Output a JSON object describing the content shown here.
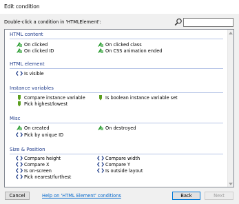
{
  "window": {
    "title": "Edit condition"
  },
  "prompt": "Double-click a condition in 'HTMLElement':",
  "search": {
    "value": "",
    "placeholder": ""
  },
  "groups": [
    {
      "title": "HTML content",
      "items": [
        {
          "label": "On clicked",
          "icon": "trigger-arrow-icon"
        },
        {
          "label": "On clicked class",
          "icon": "trigger-arrow-icon"
        },
        {
          "label": "On clicked ID",
          "icon": "trigger-arrow-icon"
        },
        {
          "label": "On CSS animation ended",
          "icon": "trigger-arrow-icon"
        }
      ]
    },
    {
      "title": "HTML element",
      "items": [
        {
          "label": "Is visible",
          "icon": "code-brackets-icon"
        }
      ]
    },
    {
      "title": "Instance variables",
      "items": [
        {
          "label": "Compare instance variable",
          "icon": "variable-tag-icon"
        },
        {
          "label": "Is boolean instance variable set",
          "icon": "variable-tag-icon"
        },
        {
          "label": "Pick highest/lowest",
          "icon": "variable-tag-icon"
        }
      ]
    },
    {
      "title": "Misc",
      "items": [
        {
          "label": "On created",
          "icon": "trigger-arrow-icon"
        },
        {
          "label": "On destroyed",
          "icon": "trigger-arrow-icon"
        },
        {
          "label": "Pick by unique ID",
          "icon": "code-brackets-icon"
        }
      ]
    },
    {
      "title": "Size & Position",
      "items": [
        {
          "label": "Compare height",
          "icon": "code-brackets-icon"
        },
        {
          "label": "Compare width",
          "icon": "code-brackets-icon"
        },
        {
          "label": "Compare X",
          "icon": "code-brackets-icon"
        },
        {
          "label": "Compare Y",
          "icon": "code-brackets-icon"
        },
        {
          "label": "Is on-screen",
          "icon": "code-brackets-icon"
        },
        {
          "label": "Is outside layout",
          "icon": "code-brackets-icon"
        },
        {
          "label": "Pick nearest/furthest",
          "icon": "code-brackets-icon"
        }
      ]
    }
  ],
  "buttons": {
    "cancel": "Cancel",
    "back": "Back",
    "next": "Next"
  },
  "help_link": "Help on 'HTML Element' conditions",
  "colors": {
    "group_header": "#1e3a8a",
    "trigger_green": "#2e9e35",
    "variable_green": "#5a9e1e",
    "brackets_navy": "#1f3c88",
    "link": "#0066cc"
  }
}
